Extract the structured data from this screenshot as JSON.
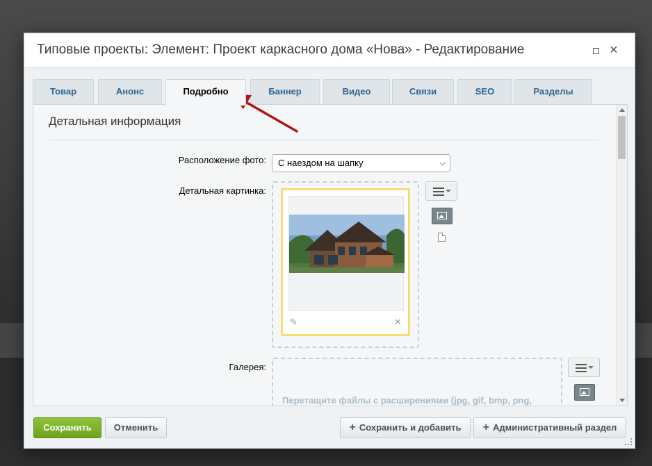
{
  "dialog": {
    "title": "Типовые проекты: Элемент: Проект каркасного дома «Нова» - Редактирование"
  },
  "tabs": [
    {
      "label": "Товар"
    },
    {
      "label": "Анонс"
    },
    {
      "label": "Подробно",
      "active": true
    },
    {
      "label": "Баннер"
    },
    {
      "label": "Видео"
    },
    {
      "label": "Связи"
    },
    {
      "label": "SEO"
    },
    {
      "label": "Разделы"
    }
  ],
  "section": {
    "title": "Детальная информация"
  },
  "fields": {
    "photo_position_label": "Расположение фото:",
    "photo_position_value": "С наездом на шапку",
    "detail_picture_label": "Детальная картинка:",
    "gallery_label": "Галерея:",
    "gallery_hint": "Перетащите файлы с расширениями (jpg, gif, bmp, png,"
  },
  "footer": {
    "save_label": "Сохранить",
    "cancel_label": "Отменить",
    "save_add_label": "Сохранить и добавить",
    "admin_section_label": "Административный раздел"
  },
  "colors": {
    "save_button": "#7fb32c",
    "tab_text": "#2f6591",
    "picture_border": "#f5dd72",
    "annotation_arrow": "#b31414"
  },
  "icons": {
    "picture_edit": "pencil-icon",
    "picture_delete": "close-icon",
    "menu": "menu-icon",
    "image_source": "image-icon",
    "file_source": "file-icon"
  }
}
